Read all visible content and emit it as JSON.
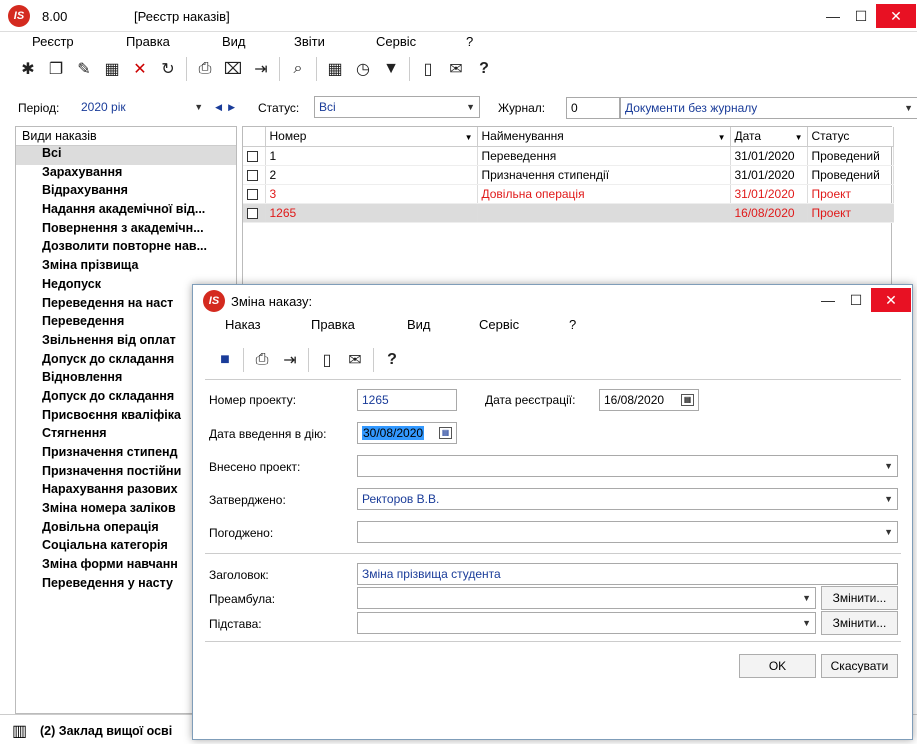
{
  "window": {
    "logo": "IS",
    "version": "8.00",
    "title": "[Реєстр наказів]"
  },
  "menu": [
    "Реєстр",
    "Правка",
    "Вид",
    "Звіти",
    "Сервіс",
    "?"
  ],
  "toolbar_icons": [
    "new-doc-icon",
    "copy-icon",
    "edit-icon",
    "table-icon",
    "delete-icon",
    "refresh-icon",
    "print-icon",
    "filter-clear-icon",
    "exit-icon",
    "search-icon",
    "grid-icon",
    "schedule-icon",
    "filter-icon",
    "form-icon",
    "mail-icon",
    "help-icon"
  ],
  "filters": {
    "period_label": "Період:",
    "period_value": "2020 рік",
    "status_label": "Статус:",
    "status_value": "Всі",
    "journal_label": "Журнал:",
    "journal_number": "0",
    "journal_value": "Документи без журналу"
  },
  "left_panel": {
    "header": "Види наказів",
    "items": [
      "Всі",
      "Зарахування",
      "Відрахування",
      "Надання академічної від...",
      "Повернення з академічн...",
      "Дозволити повторне нав...",
      "Зміна прізвища",
      "Недопуск",
      "Переведення на наст",
      "Переведення",
      "Звільнення від оплат",
      "Допуск до складання",
      "Відновлення",
      "Допуск до складання",
      "Присвоєння кваліфіка",
      "Стягнення",
      "Призначення стипенд",
      "Призначення постійни",
      "Нарахування разових",
      "Зміна номера заліков",
      "Довільна операція",
      "Соціальна категорія",
      "Зміна форми навчанн",
      "Переведення у насту"
    ]
  },
  "grid": {
    "columns": [
      "Номер",
      "Найменування",
      "Дата",
      "Статус"
    ],
    "rows": [
      {
        "num": "1",
        "name": "Переведення",
        "date": "31/01/2020",
        "status": "Проведений"
      },
      {
        "num": "2",
        "name": "Призначення стипендії",
        "date": "31/01/2020",
        "status": "Проведений"
      },
      {
        "num": "3",
        "name": "Довільна операція",
        "date": "31/01/2020",
        "status": "Проект"
      },
      {
        "num": "1265",
        "name": "",
        "date": "16/08/2020",
        "status": "Проект"
      }
    ]
  },
  "statusbar": {
    "text": "(2) Заклад вищої осві"
  },
  "dialog": {
    "logo": "IS",
    "title": "Зміна наказу:",
    "menu": [
      "Наказ",
      "Правка",
      "Вид",
      "Сервіс",
      "?"
    ],
    "toolbar_icons": [
      "save-icon",
      "print-icon",
      "exit-icon",
      "form-icon",
      "mail-icon",
      "help-icon"
    ],
    "project_number_label": "Номер проекту:",
    "project_number": "1265",
    "reg_date_label": "Дата реєстрації:",
    "reg_date": "16/08/2020",
    "effective_date_label": "Дата введення в дію:",
    "effective_date": "30/08/2020",
    "submitted_label": "Внесено проект:",
    "submitted_value": "",
    "approved_label": "Затверджено:",
    "approved_value": "Ректоров В.В.",
    "agreed_label": "Погоджено:",
    "agreed_value": "",
    "heading_label": "Заголовок:",
    "heading_value": "Зміна прізвища студента",
    "preamble_label": "Преамбула:",
    "preamble_value": "",
    "basis_label": "Підстава:",
    "basis_value": "",
    "change_button": "Змінити...",
    "ok_button": "OK",
    "cancel_button": "Скасувати"
  },
  "colors": {
    "accent": "#1a3c99",
    "red": "#e01a1a",
    "close": "#e81123",
    "logo": "#d42a1f"
  }
}
